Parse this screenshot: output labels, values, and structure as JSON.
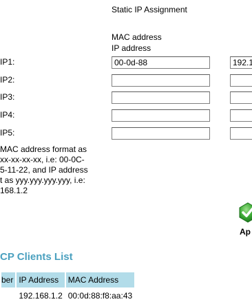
{
  "static_ip": {
    "title": "Static IP Assignment",
    "mac_column_label": "MAC address",
    "ip_column_label": "IP address",
    "rows": [
      {
        "label": "IP1:",
        "mac_value": "00-0d-88",
        "ip_value": "192.1"
      },
      {
        "label": "IP2:",
        "mac_value": "",
        "ip_value": ""
      },
      {
        "label": "IP3:",
        "mac_value": "",
        "ip_value": ""
      },
      {
        "label": "IP4:",
        "mac_value": "",
        "ip_value": ""
      },
      {
        "label": "IP5:",
        "mac_value": "",
        "ip_value": ""
      }
    ],
    "note_lines": [
      "MAC address format as",
      "xx-xx-xx-xx, i.e: 00-0C-",
      "5-11-22, and IP address",
      "t as yyy.yyy.yyy.yyy, i.e:",
      "168.1.2"
    ]
  },
  "apply_button": {
    "label": "Ap",
    "icon": "green-checkmark-icon",
    "color": "#2e9e2e"
  },
  "clients": {
    "title": "CP Clients List",
    "headers": [
      "ber",
      "IP Address",
      "MAC Address"
    ],
    "rows": [
      [
        "",
        "192.168.1.2",
        "00:0d:88:f8:aa:43"
      ]
    ]
  }
}
